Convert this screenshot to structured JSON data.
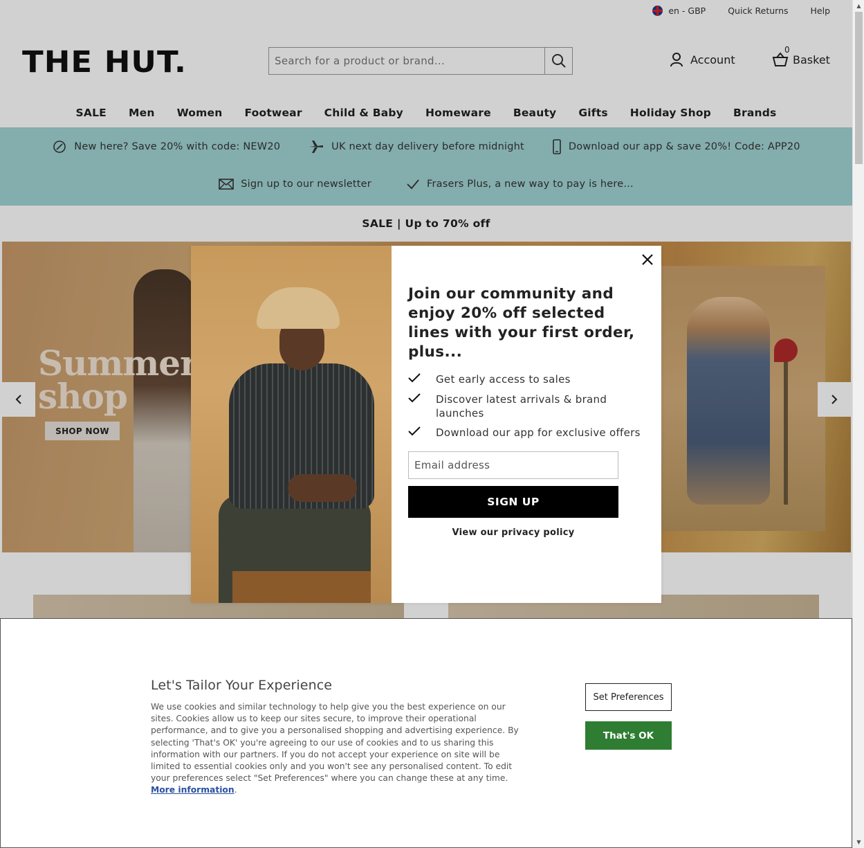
{
  "utility": {
    "locale": "en - GBP",
    "quick_returns": "Quick Returns",
    "help": "Help"
  },
  "header": {
    "logo": "THE HUT.",
    "search_placeholder": "Search for a product or brand...",
    "account": "Account",
    "basket": "Basket",
    "basket_count": "0"
  },
  "nav": {
    "items": [
      "SALE",
      "Men",
      "Women",
      "Footwear",
      "Child & Baby",
      "Homeware",
      "Beauty",
      "Gifts",
      "Holiday Shop",
      "Brands"
    ]
  },
  "promo": {
    "new_here": "New here? Save 20% with code: NEW20",
    "delivery": "UK next day delivery before midnight",
    "app": "Download our app & save 20%! Code: APP20",
    "newsletter": "Sign up to our newsletter",
    "frasers": "Frasers Plus, a new way to pay is here..."
  },
  "sale_strip": "SALE | Up to 70% off",
  "hero": {
    "title_line1": "Summer",
    "title_line2": "shop",
    "cta": "SHOP NOW"
  },
  "modal": {
    "title": "Join our community and enjoy 20% off selected lines with your first order, plus...",
    "benefits": [
      "Get early access to sales",
      "Discover latest arrivals & brand launches",
      "Download our app for exclusive offers"
    ],
    "email_placeholder": "Email address",
    "signup": "SIGN UP",
    "privacy": "View our privacy policy"
  },
  "cookie": {
    "title": "Let's Tailor Your Experience",
    "body": "We use cookies and similar technology to help give you the best experience on our sites. Cookies allow us to keep our sites secure, to improve their operational performance, and to give you a personalised shopping and advertising experience. By selecting 'That's OK' you're agreeing to our use of cookies and to us sharing this information with our partners. If you do not accept your experience on site will be limited to essential cookies only and you won't see any personalised content. To edit your preferences select \"Set Preferences\" where you can change these at any time.",
    "more_info": "More information",
    "set_preferences": "Set Preferences",
    "thats_ok": "That's OK"
  },
  "colors": {
    "promo_bg": "#a2d4d3",
    "accept_green": "#2e7d32",
    "signup_black": "#000000"
  }
}
